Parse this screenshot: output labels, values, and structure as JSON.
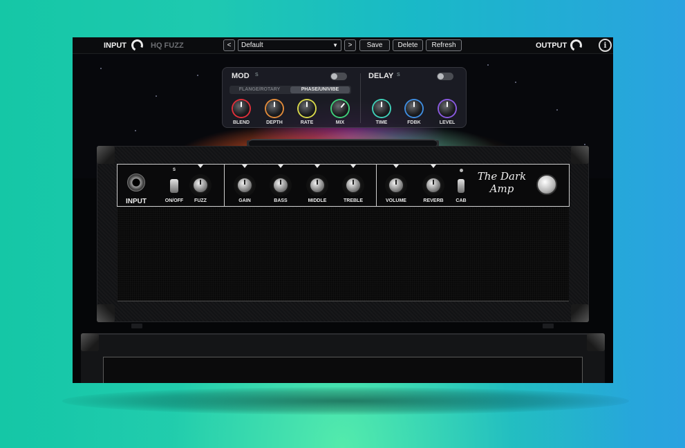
{
  "topbar": {
    "input_label": "INPUT",
    "plugin_name": "HQ FUZZ",
    "prev_label": "<",
    "preset_value": "Default",
    "next_label": ">",
    "save_label": "Save",
    "delete_label": "Delete",
    "refresh_label": "Refresh",
    "output_label": "OUTPUT",
    "info_label": "i"
  },
  "mod": {
    "title": "MOD",
    "sub": "S",
    "mode_a": "FLANGE/ROTARY",
    "mode_b": "PHASE/UNIVIBE",
    "selected_mode": "PHASE/UNIVIBE",
    "enabled": false,
    "knobs": [
      {
        "label": "BLEND",
        "color": "#e0303a"
      },
      {
        "label": "DEPTH",
        "color": "#e08a3a"
      },
      {
        "label": "RATE",
        "color": "#d8d84a"
      },
      {
        "label": "MIX",
        "color": "#3fd07a"
      }
    ]
  },
  "delay": {
    "title": "DELAY",
    "sub": "S",
    "enabled": false,
    "knobs": [
      {
        "label": "TIME",
        "color": "#3fd0b8"
      },
      {
        "label": "FDBK",
        "color": "#3f8de0"
      },
      {
        "label": "LEVEL",
        "color": "#8a5ae0"
      }
    ]
  },
  "amp": {
    "input_label": "INPUT",
    "s_label": "S",
    "onoff_label": "ON/OFF",
    "fuzz_label": "FUZZ",
    "gain_label": "GAIN",
    "bass_label": "BASS",
    "middle_label": "MIDDLE",
    "treble_label": "TREBLE",
    "volume_label": "VOLUME",
    "reverb_label": "REVERB",
    "cab_label": "CAB",
    "logo_line1": "The Dark",
    "logo_line2": "Amp"
  }
}
